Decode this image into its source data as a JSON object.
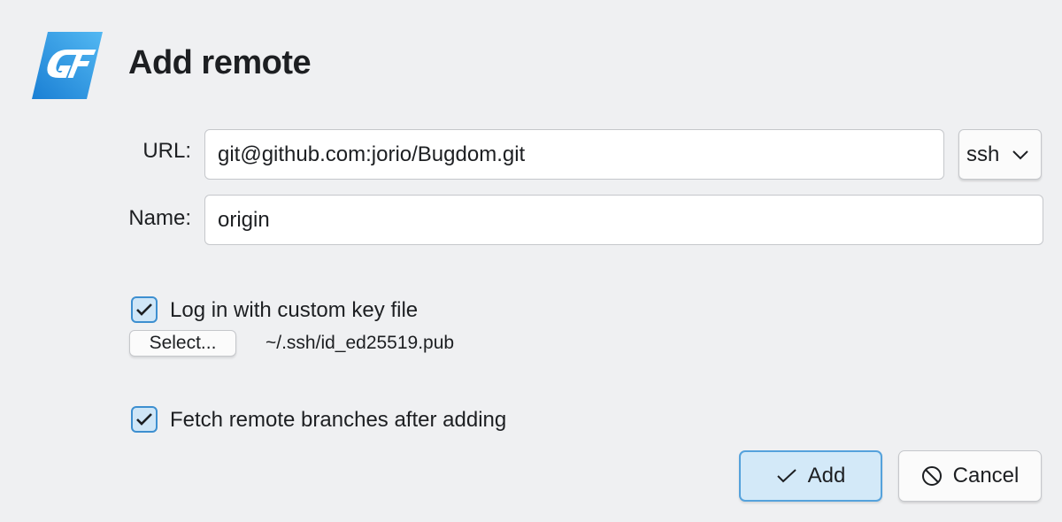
{
  "dialog": {
    "title": "Add remote",
    "logo_icon": "gf-logo-icon"
  },
  "form": {
    "url_label": "URL:",
    "url_value": "git@github.com:jorio/Bugdom.git",
    "protocol_selected": "ssh",
    "name_label": "Name:",
    "name_value": "origin"
  },
  "key_file": {
    "checkbox_label": "Log in with custom key file",
    "checked": true,
    "select_button_label": "Select...",
    "path": "~/.ssh/id_ed25519.pub"
  },
  "fetch": {
    "checkbox_label": "Fetch remote branches after adding",
    "checked": true
  },
  "buttons": {
    "add_label": "Add",
    "add_icon": "checkmark-icon",
    "cancel_label": "Cancel",
    "cancel_icon": "cancel-circle-icon"
  },
  "colors": {
    "accent": "#3d8fd0",
    "accent_light": "#d3e9f8",
    "background": "#eff0f2"
  }
}
